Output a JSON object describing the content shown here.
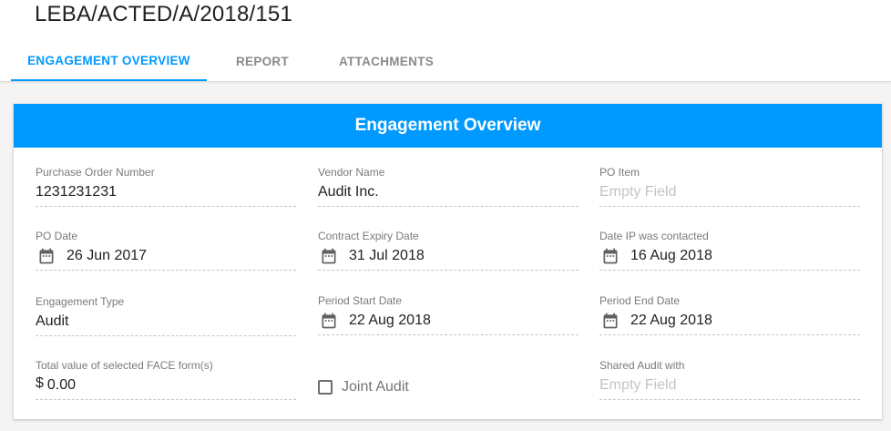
{
  "page": {
    "title": "LEBA/ACTED/A/2018/151"
  },
  "tabs": [
    {
      "label": "ENGAGEMENT OVERVIEW",
      "active": true
    },
    {
      "label": "REPORT",
      "active": false
    },
    {
      "label": "ATTACHMENTS",
      "active": false
    }
  ],
  "card": {
    "title": "Engagement Overview",
    "fields": {
      "po_number": {
        "label": "Purchase Order Number",
        "value": "1231231231"
      },
      "vendor_name": {
        "label": "Vendor Name",
        "value": "Audit Inc."
      },
      "po_item": {
        "label": "PO Item",
        "placeholder": "Empty Field"
      },
      "po_date": {
        "label": "PO Date",
        "value": "26 Jun 2017"
      },
      "contract_expiry": {
        "label": "Contract Expiry Date",
        "value": "31 Jul 2018"
      },
      "ip_contacted": {
        "label": "Date IP was contacted",
        "value": "16 Aug 2018"
      },
      "engagement_type": {
        "label": "Engagement Type",
        "value": "Audit"
      },
      "period_start": {
        "label": "Period Start Date",
        "value": "22 Aug 2018"
      },
      "period_end": {
        "label": "Period End Date",
        "value": "22 Aug 2018"
      },
      "face_total": {
        "label": "Total value of selected FACE form(s)",
        "currency": "$",
        "value": "0.00"
      },
      "joint_audit": {
        "label": "Joint Audit",
        "checked": false
      },
      "shared_audit": {
        "label": "Shared Audit with",
        "placeholder": "Empty Field"
      }
    }
  },
  "colors": {
    "accent": "#0099ff",
    "header_text": "#ffffff",
    "label": "#7a7a7a",
    "placeholder": "#c4c4c4"
  },
  "icons": {
    "date": "calendar-icon"
  }
}
